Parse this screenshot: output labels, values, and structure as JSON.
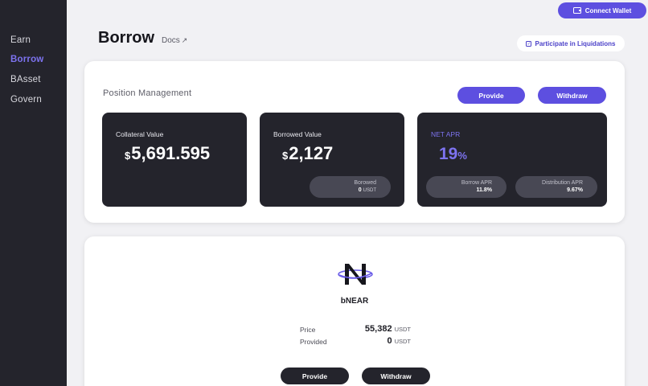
{
  "sidebar": {
    "items": [
      {
        "label": "Earn"
      },
      {
        "label": "Borrow",
        "active": true
      },
      {
        "label": "BAsset"
      },
      {
        "label": "Govern"
      }
    ]
  },
  "header": {
    "connect_wallet": "Connect Wallet",
    "title": "Borrow",
    "docs": "Docs",
    "liquidations": "Participate in Liquidations"
  },
  "position": {
    "title": "Position Management",
    "provide_label": "Provide",
    "withdraw_label": "Withdraw",
    "collateral": {
      "label": "Collateral Value",
      "currency": "$",
      "value": "5,691.595"
    },
    "borrowed": {
      "label": "Borrowed Value",
      "currency": "$",
      "value": "2,127",
      "sub_label": "Borowed",
      "sub_value": "0",
      "sub_unit": "USDT"
    },
    "net_apr": {
      "label": "NET APR",
      "value": "19",
      "unit": "%",
      "borrow_apr": {
        "label": "Borrow APR",
        "value": "11.8%"
      },
      "distribution_apr": {
        "label": "Distribution APR",
        "value": "9.67%"
      }
    }
  },
  "asset": {
    "name": "bNEAR",
    "price_label": "Price",
    "price_value": "55,382",
    "price_unit": "USDT",
    "provided_label": "Provided",
    "provided_value": "0",
    "provided_unit": "USDT",
    "provide_label": "Provide",
    "withdraw_label": "Withdraw"
  },
  "colors": {
    "accent": "#5d4fe0",
    "accent_text": "#7d73f0",
    "dark": "#24242c"
  }
}
